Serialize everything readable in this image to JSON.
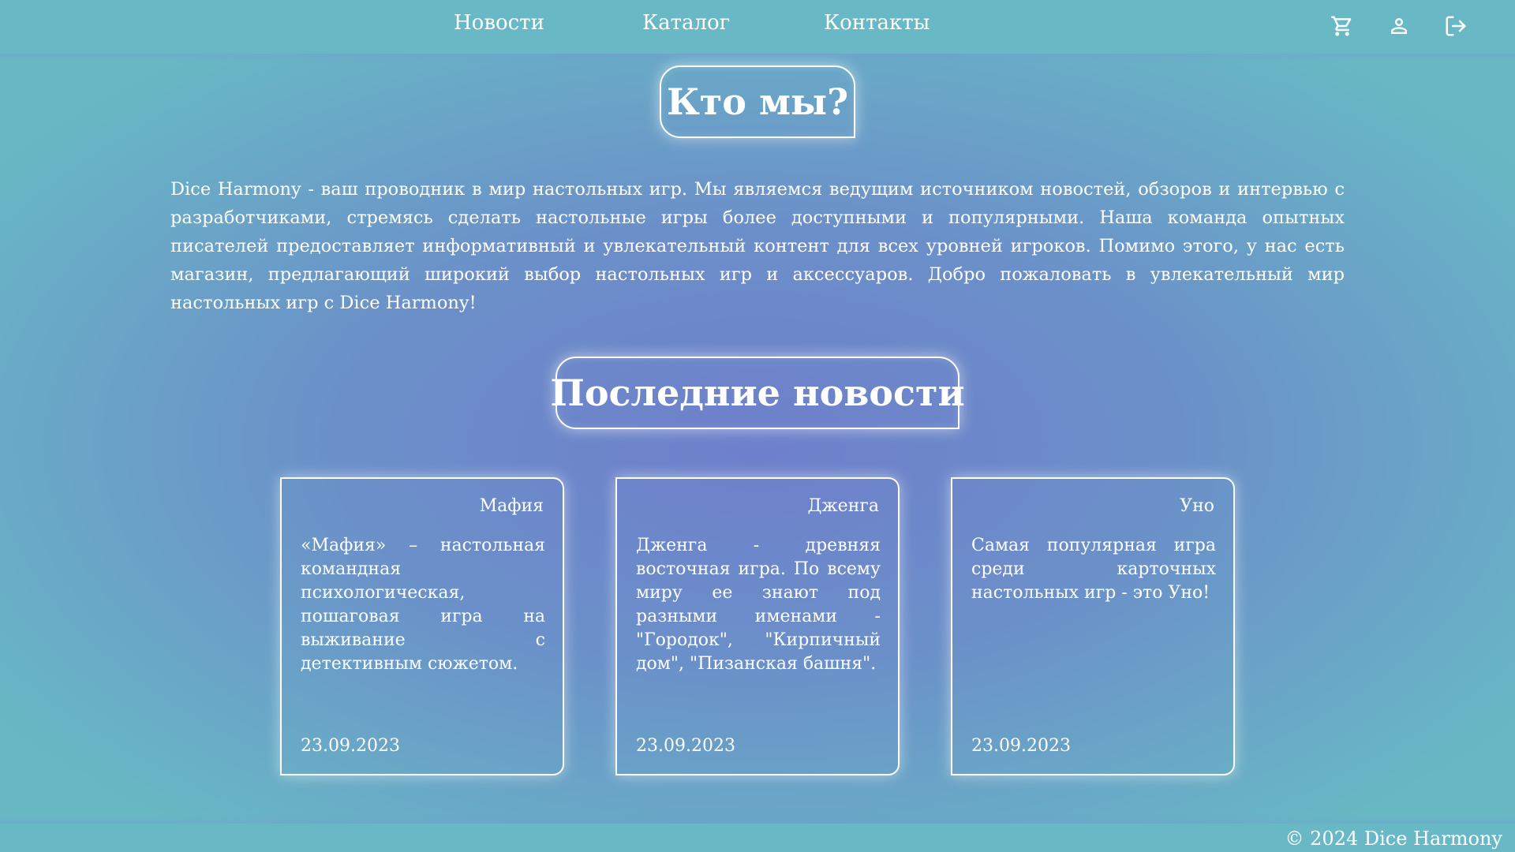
{
  "nav": {
    "items": [
      {
        "label": "Новости"
      },
      {
        "label": "Каталог"
      },
      {
        "label": "Контакты"
      }
    ],
    "icons": [
      "cart-icon",
      "user-icon",
      "logout-icon"
    ]
  },
  "about": {
    "title": "Кто мы?",
    "text": "Dice Harmony - ваш проводник в мир настольных игр. Мы являемся ведущим источником новостей, обзоров и интервью с разработчиками, стремясь сделать настольные игры более доступными и популярными. Наша команда опытных писателей предоставляет информативный и увлекательный контент для всех уровней игроков. Помимо этого, у нас есть магазин, предлагающий широкий выбор настольных игр и аксессуаров. Добро пожаловать в увлекательный мир настольных игр с Dice Harmony!"
  },
  "news": {
    "title": "Последние новости",
    "cards": [
      {
        "title": "Мафия",
        "text": "«Мафия» – настольная командная психологическая, пошаговая игра на выживание с детективным сюжетом.",
        "date": "23.09.2023"
      },
      {
        "title": "Дженга",
        "text": "Дженга - древняя восточная игра. По всему миру ее знают под разными именами - \"Городок\", \"Кирпичный дом\", \"Пизанская башня\".",
        "date": "23.09.2023"
      },
      {
        "title": "Уно",
        "text": "Самая популярная игра среди карточных настольных игр - это Уно!",
        "date": "23.09.2023"
      }
    ]
  },
  "footer": {
    "text": "© 2024 Dice Harmony"
  },
  "colors": {
    "header_bg": "#69b8c5",
    "center_bg": "#6e7fcb",
    "text": "#ffffff"
  }
}
